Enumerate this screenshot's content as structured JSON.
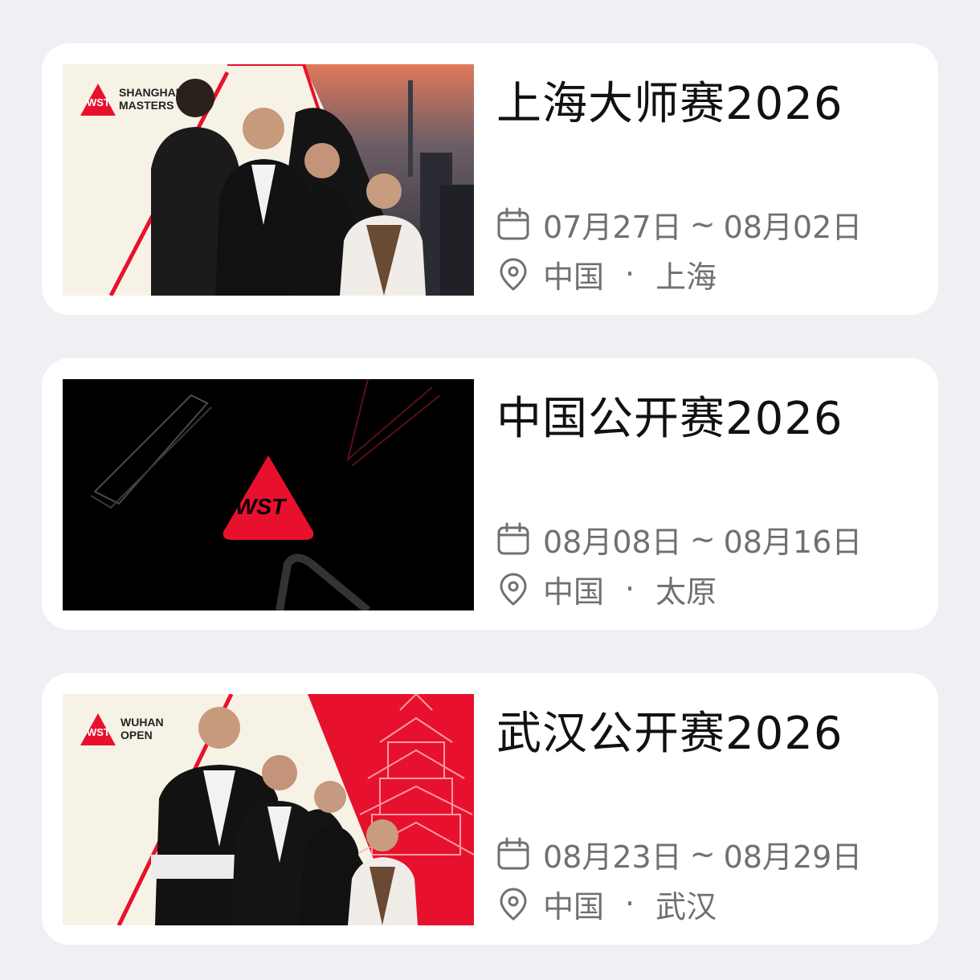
{
  "events": [
    {
      "title": "上海大师赛2026",
      "date_start": "07月27日",
      "date_sep": "~",
      "date_end": "08月02日",
      "country": "中国",
      "loc_sep": "·",
      "city": "上海",
      "banner": {
        "logo_mark": "WST",
        "logo_line1": "SHANGHAI",
        "logo_line2": "MASTERS"
      }
    },
    {
      "title": "中国公开赛2026",
      "date_start": "08月08日",
      "date_sep": "~",
      "date_end": "08月16日",
      "country": "中国",
      "loc_sep": "·",
      "city": "太原",
      "banner": {
        "logo_mark": "WST"
      }
    },
    {
      "title": "武汉公开赛2026",
      "date_start": "08月23日",
      "date_sep": "~",
      "date_end": "08月29日",
      "country": "中国",
      "loc_sep": "·",
      "city": "武汉",
      "banner": {
        "logo_mark": "WST",
        "logo_line1": "WUHAN",
        "logo_line2": "OPEN"
      }
    }
  ],
  "icons": {
    "date": "calendar-icon",
    "location": "location-pin-icon"
  },
  "colors": {
    "brand_red": "#e8112d",
    "card_bg": "#ffffff",
    "page_bg": "#eff0f3",
    "title": "#111111",
    "meta": "#707070"
  }
}
